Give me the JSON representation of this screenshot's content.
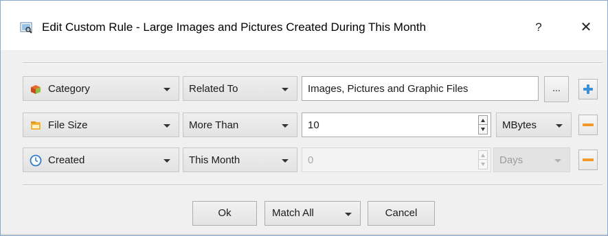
{
  "window": {
    "title": "Edit Custom Rule - Large Images and Pictures Created During This Month",
    "help_label": "?",
    "close_label": "✕"
  },
  "rules": [
    {
      "field": "Category",
      "field_icon": "category-icon",
      "operator": "Related To",
      "value": "Images, Pictures and Graphic Files",
      "browse_label": "..."
    },
    {
      "field": "File Size",
      "field_icon": "file-size-icon",
      "operator": "More Than",
      "value": "10",
      "unit": "MBytes"
    },
    {
      "field": "Created",
      "field_icon": "clock-icon",
      "operator": "This Month",
      "value": "0",
      "unit": "Days",
      "value_disabled": true
    }
  ],
  "footer": {
    "ok_label": "Ok",
    "match_label": "Match All",
    "cancel_label": "Cancel"
  },
  "colors": {
    "add_accent": "#3b8fd6",
    "remove_accent": "#f29a28",
    "window_border": "#8aa6c8"
  }
}
